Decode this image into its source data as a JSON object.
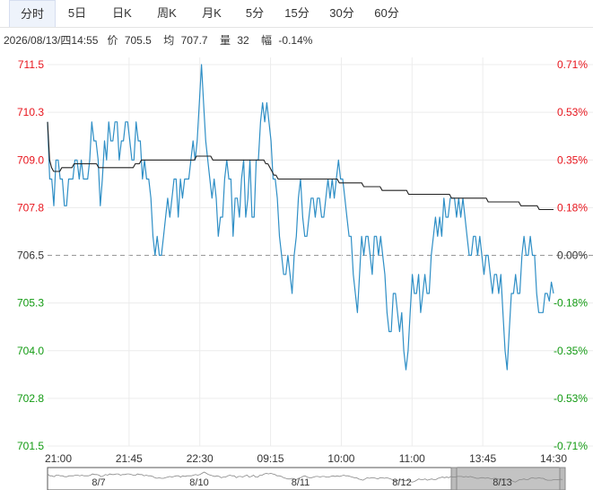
{
  "tabs": [
    {
      "label": "分时",
      "active": true
    },
    {
      "label": "5日"
    },
    {
      "label": "日K"
    },
    {
      "label": "周K"
    },
    {
      "label": "月K"
    },
    {
      "label": "5分"
    },
    {
      "label": "15分"
    },
    {
      "label": "30分"
    },
    {
      "label": "60分"
    }
  ],
  "info": {
    "datetime": "2026/08/13/四14:55",
    "price_label": "价",
    "price": "705.5",
    "avg_label": "均",
    "avg": "707.7",
    "vol_label": "量",
    "vol": "32",
    "chg_label": "幅",
    "chg": "-0.14%"
  },
  "colors": {
    "up": "#e8151d",
    "down": "#139b13",
    "base": "#333333",
    "price_line": "#2f8fc6",
    "avg_line": "#222222",
    "grid": "#ececec"
  },
  "chart_data": {
    "type": "line",
    "base_price": 706.5,
    "ylim": [
      701.5,
      711.5
    ],
    "y_ticks": [
      "711.5",
      "710.3",
      "709.0",
      "707.8",
      "706.5",
      "705.3",
      "704.0",
      "702.8",
      "701.5"
    ],
    "pct_ticks": [
      "0.71%",
      "0.53%",
      "0.35%",
      "0.18%",
      "0.00%",
      "-0.18%",
      "-0.35%",
      "-0.53%",
      "-0.71%"
    ],
    "x_ticks": [
      "21:00",
      "21:45",
      "22:30",
      "09:15",
      "10:00",
      "11:00",
      "13:45",
      "14:30"
    ],
    "dates": [
      "8/7",
      "8/10",
      "8/11",
      "8/12",
      "8/13"
    ],
    "series": [
      {
        "name": "价",
        "values": [
          710.0,
          708.5,
          708.5,
          707.8,
          709.0,
          709.0,
          708.5,
          708.5,
          707.8,
          707.8,
          708.5,
          708.5,
          708.5,
          709.0,
          709.0,
          708.5,
          709.0,
          708.5,
          708.5,
          708.5,
          709.0,
          710.0,
          709.5,
          709.5,
          709.0,
          707.8,
          708.5,
          709.5,
          709.0,
          710.0,
          709.5,
          709.5,
          710.0,
          710.0,
          709.0,
          709.5,
          709.5,
          710.0,
          710.0,
          709.5,
          709.0,
          709.0,
          710.0,
          709.5,
          709.5,
          708.5,
          709.0,
          708.5,
          708.5,
          708.0,
          707.0,
          706.5,
          707.0,
          706.5,
          706.5,
          707.0,
          707.5,
          708.0,
          707.5,
          708.0,
          708.5,
          708.5,
          707.5,
          708.5,
          708.0,
          708.5,
          708.5,
          708.5,
          709.0,
          709.5,
          709.0,
          709.5,
          710.5,
          711.5,
          710.5,
          709.5,
          709.0,
          708.5,
          708.0,
          708.5,
          708.0,
          707.0,
          707.5,
          707.5,
          708.5,
          709.0,
          708.5,
          708.5,
          707.0,
          708.0,
          708.0,
          707.5,
          708.5,
          709.0,
          707.5,
          708.0,
          709.0,
          707.5,
          707.5,
          709.0,
          709.0,
          710.0,
          710.5,
          710.0,
          710.5,
          710.0,
          709.5,
          708.5,
          708.5,
          708.0,
          707.0,
          706.5,
          706.0,
          706.0,
          706.5,
          706.0,
          705.5,
          706.5,
          707.0,
          708.0,
          708.5,
          707.5,
          707.0,
          707.0,
          707.5,
          708.0,
          708.0,
          707.5,
          708.0,
          708.0,
          707.5,
          707.5,
          708.0,
          708.5,
          708.0,
          708.5,
          708.0,
          708.5,
          709.0,
          708.5,
          708.5,
          708.0,
          707.5,
          707.0,
          707.0,
          706.0,
          705.5,
          705.0,
          706.0,
          707.0,
          706.5,
          707.0,
          707.0,
          706.5,
          706.0,
          707.0,
          707.0,
          706.5,
          707.0,
          706.5,
          706.0,
          705.0,
          704.5,
          704.5,
          705.5,
          705.5,
          705.0,
          704.5,
          705.0,
          704.0,
          703.5,
          704.0,
          705.0,
          706.0,
          705.5,
          705.5,
          706.0,
          705.0,
          705.5,
          706.0,
          705.5,
          705.5,
          706.5,
          707.0,
          707.5,
          707.0,
          707.5,
          707.0,
          708.0,
          707.5,
          707.5,
          708.0,
          708.0,
          708.0,
          707.5,
          708.0,
          707.5,
          708.0,
          707.5,
          707.0,
          706.5,
          706.5,
          707.0,
          707.0,
          706.5,
          707.0,
          706.5,
          706.0,
          706.5,
          706.5,
          706.0,
          705.5,
          706.0,
          706.0,
          705.5,
          706.0,
          705.0,
          704.0,
          703.5,
          704.5,
          705.5,
          705.5,
          706.0,
          705.5,
          705.5,
          706.5,
          707.0,
          706.5,
          706.5,
          707.0,
          706.5,
          706.5,
          705.5,
          705.0,
          705.0,
          705.0,
          705.5,
          705.5,
          705.3,
          705.8,
          705.5
        ]
      },
      {
        "name": "均",
        "values": [
          710.0,
          709.0,
          708.8,
          708.7,
          708.7,
          708.7,
          708.7,
          708.8,
          708.8,
          708.8,
          708.8,
          708.8,
          708.8,
          708.9,
          708.9,
          708.9,
          708.9,
          708.9,
          708.9,
          708.9,
          708.9,
          708.9,
          708.9,
          708.9,
          708.9,
          708.8,
          708.8,
          708.8,
          708.8,
          708.8,
          708.8,
          708.8,
          708.8,
          708.8,
          708.8,
          708.8,
          708.8,
          708.8,
          708.8,
          708.8,
          708.8,
          708.8,
          708.8,
          708.9,
          708.9,
          708.9,
          709.0,
          709.0,
          709.0,
          709.0,
          709.0,
          709.0,
          709.0,
          709.0,
          709.0,
          709.0,
          709.0,
          709.0,
          709.0,
          709.0,
          709.0,
          709.0,
          709.0,
          709.0,
          709.0,
          709.0,
          709.0,
          709.0,
          709.0,
          709.0,
          709.0,
          709.0,
          709.0,
          709.1,
          709.1,
          709.1,
          709.1,
          709.1,
          709.1,
          709.1,
          709.1,
          709.0,
          709.0,
          709.0,
          709.0,
          709.0,
          709.0,
          709.0,
          709.0,
          709.0,
          709.0,
          709.0,
          709.0,
          709.0,
          709.0,
          709.0,
          709.0,
          709.0,
          709.0,
          709.0,
          709.0,
          709.0,
          709.0,
          709.0,
          709.0,
          709.0,
          709.0,
          708.9,
          708.9,
          708.8,
          708.7,
          708.6,
          708.6,
          708.5,
          708.5,
          708.5,
          708.5,
          708.5,
          708.5,
          708.5,
          708.5,
          708.5,
          708.5,
          708.5,
          708.5,
          708.5,
          708.5,
          708.5,
          708.5,
          708.5,
          708.5,
          708.5,
          708.5,
          708.5,
          708.5,
          708.5,
          708.5,
          708.5,
          708.5,
          708.5,
          708.5,
          708.5,
          708.5,
          708.4,
          708.4,
          708.4,
          708.4,
          708.4,
          708.4,
          708.4,
          708.4,
          708.4,
          708.4,
          708.4,
          708.4,
          708.3,
          708.3,
          708.3,
          708.3,
          708.3,
          708.3,
          708.3,
          708.3,
          708.3,
          708.2,
          708.2,
          708.2,
          708.2,
          708.2,
          708.2,
          708.2,
          708.2,
          708.2,
          708.2,
          708.2,
          708.2,
          708.2,
          708.1,
          708.1,
          708.1,
          708.1,
          708.1,
          708.1,
          708.1,
          708.1,
          708.1,
          708.1,
          708.1,
          708.1,
          708.1,
          708.1,
          708.1,
          708.1,
          708.1,
          708.1,
          708.1,
          708.1,
          708.1,
          708.0,
          708.0,
          708.0,
          708.0,
          708.0,
          708.0,
          708.0,
          708.0,
          708.0,
          708.0,
          708.0,
          708.0,
          708.0,
          708.0,
          708.0,
          708.0,
          708.0,
          708.0,
          707.9,
          707.9,
          707.9,
          707.9,
          707.9,
          707.9,
          707.9,
          707.9,
          707.9,
          707.9,
          707.9,
          707.9,
          707.9,
          707.9,
          707.9,
          707.9,
          707.8,
          707.8,
          707.8,
          707.8,
          707.8,
          707.8,
          707.8,
          707.8,
          707.8,
          707.7,
          707.7,
          707.7,
          707.7,
          707.7,
          707.7,
          707.7,
          707.7
        ]
      }
    ],
    "grid": true
  }
}
